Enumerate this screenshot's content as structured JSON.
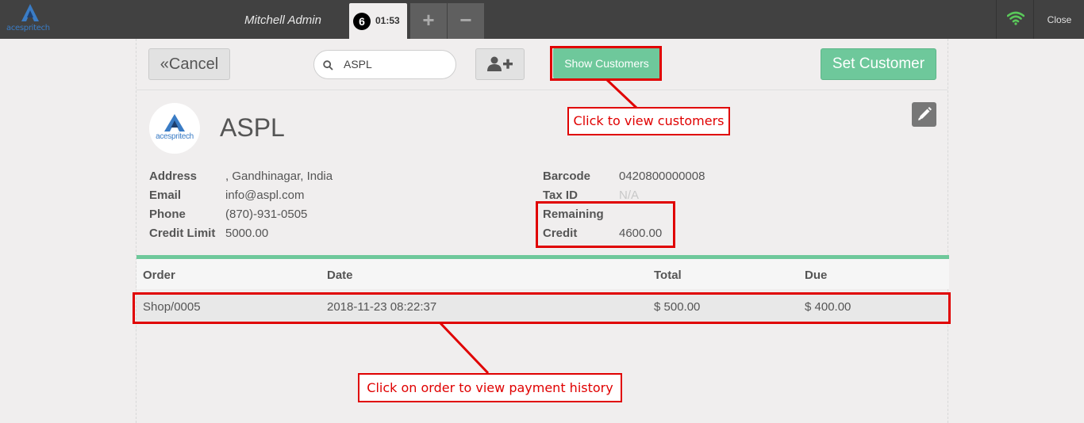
{
  "topbar": {
    "logo_text": "acespritech",
    "cashier": "Mitchell Admin",
    "order_number": "6",
    "order_time": "01:53",
    "add_order_glyph": "+",
    "remove_order_glyph": "−",
    "close_label": "Close",
    "wifi_color": "#5ac85a"
  },
  "toolbar": {
    "cancel_label": "Cancel",
    "search_value": "ASPL",
    "show_customers_label": "Show Customers",
    "set_customer_label": "Set Customer"
  },
  "customer": {
    "logo_text": "acespritech",
    "name": "ASPL",
    "left_fields": [
      {
        "label": "Address",
        "value": ", Gandhinagar, India"
      },
      {
        "label": "Email",
        "value": "info@aspl.com"
      },
      {
        "label": "Phone",
        "value": "(870)-931-0505"
      },
      {
        "label": "Credit Limit",
        "value": "5000.00"
      }
    ],
    "right_fields": [
      {
        "label": "Barcode",
        "value": "0420800000008"
      },
      {
        "label": "Tax ID",
        "value": "N/A"
      },
      {
        "label": "Remaining",
        "value": ""
      },
      {
        "label": "Credit",
        "value": "4600.00"
      }
    ]
  },
  "orders": {
    "headers": [
      "Order",
      "Date",
      "Total",
      "Due"
    ],
    "rows": [
      [
        "Shop/0005",
        "2018-11-23 08:22:37",
        "$ 500.00",
        "$ 400.00"
      ]
    ]
  },
  "annotations": {
    "customers_note": "Click to view customers",
    "history_note": "Click on order to view payment history",
    "color": "#e00000"
  },
  "colors": {
    "accent_green": "#6ec89b",
    "topbar": "#414141",
    "brand_blue": "#3a7cc5"
  }
}
